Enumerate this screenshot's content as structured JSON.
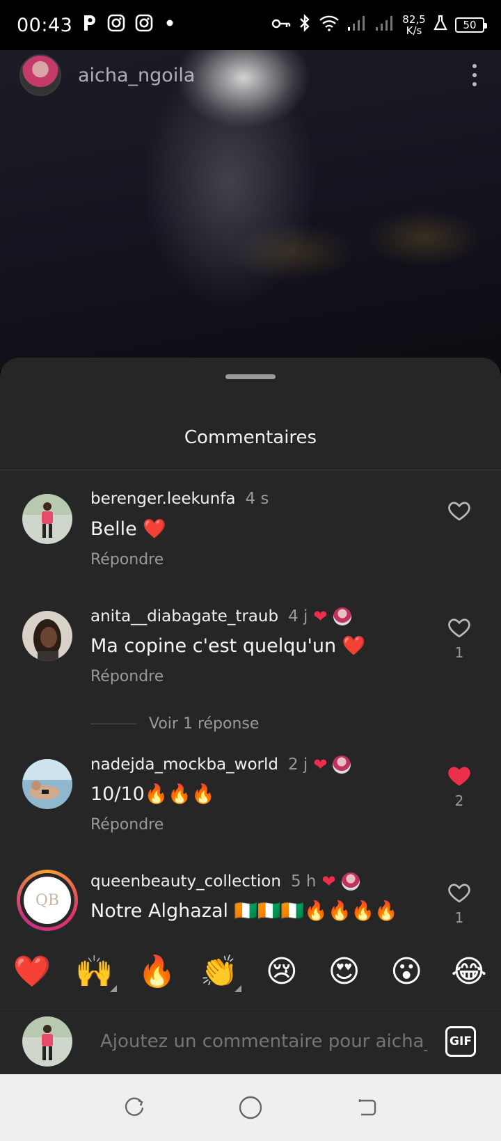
{
  "status_bar": {
    "time": "00:43",
    "net_speed_top": "82,5",
    "net_speed_bottom": "K/s",
    "battery": "50",
    "icons": [
      "p-icon",
      "instagram-icon",
      "instagram-icon",
      "dot-icon",
      "key-icon",
      "bluetooth-icon",
      "wifi-icon",
      "signal-icon",
      "signal-icon",
      "lab-icon",
      "battery-icon"
    ]
  },
  "post_header": {
    "username": "aicha_ngoila"
  },
  "sheet": {
    "title": "Commentaires"
  },
  "comments": [
    {
      "username": "berenger.leekunfa",
      "time": "4 s",
      "text": "Belle ❤️",
      "reply_label": "Répondre",
      "liked": false,
      "like_count": "",
      "author_heart": false
    },
    {
      "username": "anita__diabagate_traub",
      "time": "4 j",
      "text": "Ma copine c'est quelqu'un  ❤️",
      "reply_label": "Répondre",
      "liked": false,
      "like_count": "1",
      "author_heart": true
    },
    {
      "username": "nadejda_mockba_world",
      "time": "2 j",
      "text": "10/10🔥🔥🔥",
      "reply_label": "Répondre",
      "liked": true,
      "like_count": "2",
      "author_heart": true
    },
    {
      "username": "queenbeauty_collection",
      "time": "5 h",
      "text": "Notre Alghazal 🇨🇮🇨🇮🇨🇮🔥🔥🔥🔥",
      "reply_label": "",
      "liked": false,
      "like_count": "1",
      "author_heart": true
    }
  ],
  "view_replies": "Voir 1 réponse",
  "emoji_bar": [
    "❤️",
    "🙌",
    "🔥",
    "👏",
    "😢",
    "😍",
    "😮",
    "😂"
  ],
  "composer": {
    "placeholder": "Ajoutez un commentaire pour aicha_",
    "gif_label": "GIF"
  },
  "colors": {
    "sheet_bg": "#262626",
    "like_red": "#ed2f4c",
    "muted_text": "#9a9a9a",
    "navbar_bg": "#efefef"
  }
}
